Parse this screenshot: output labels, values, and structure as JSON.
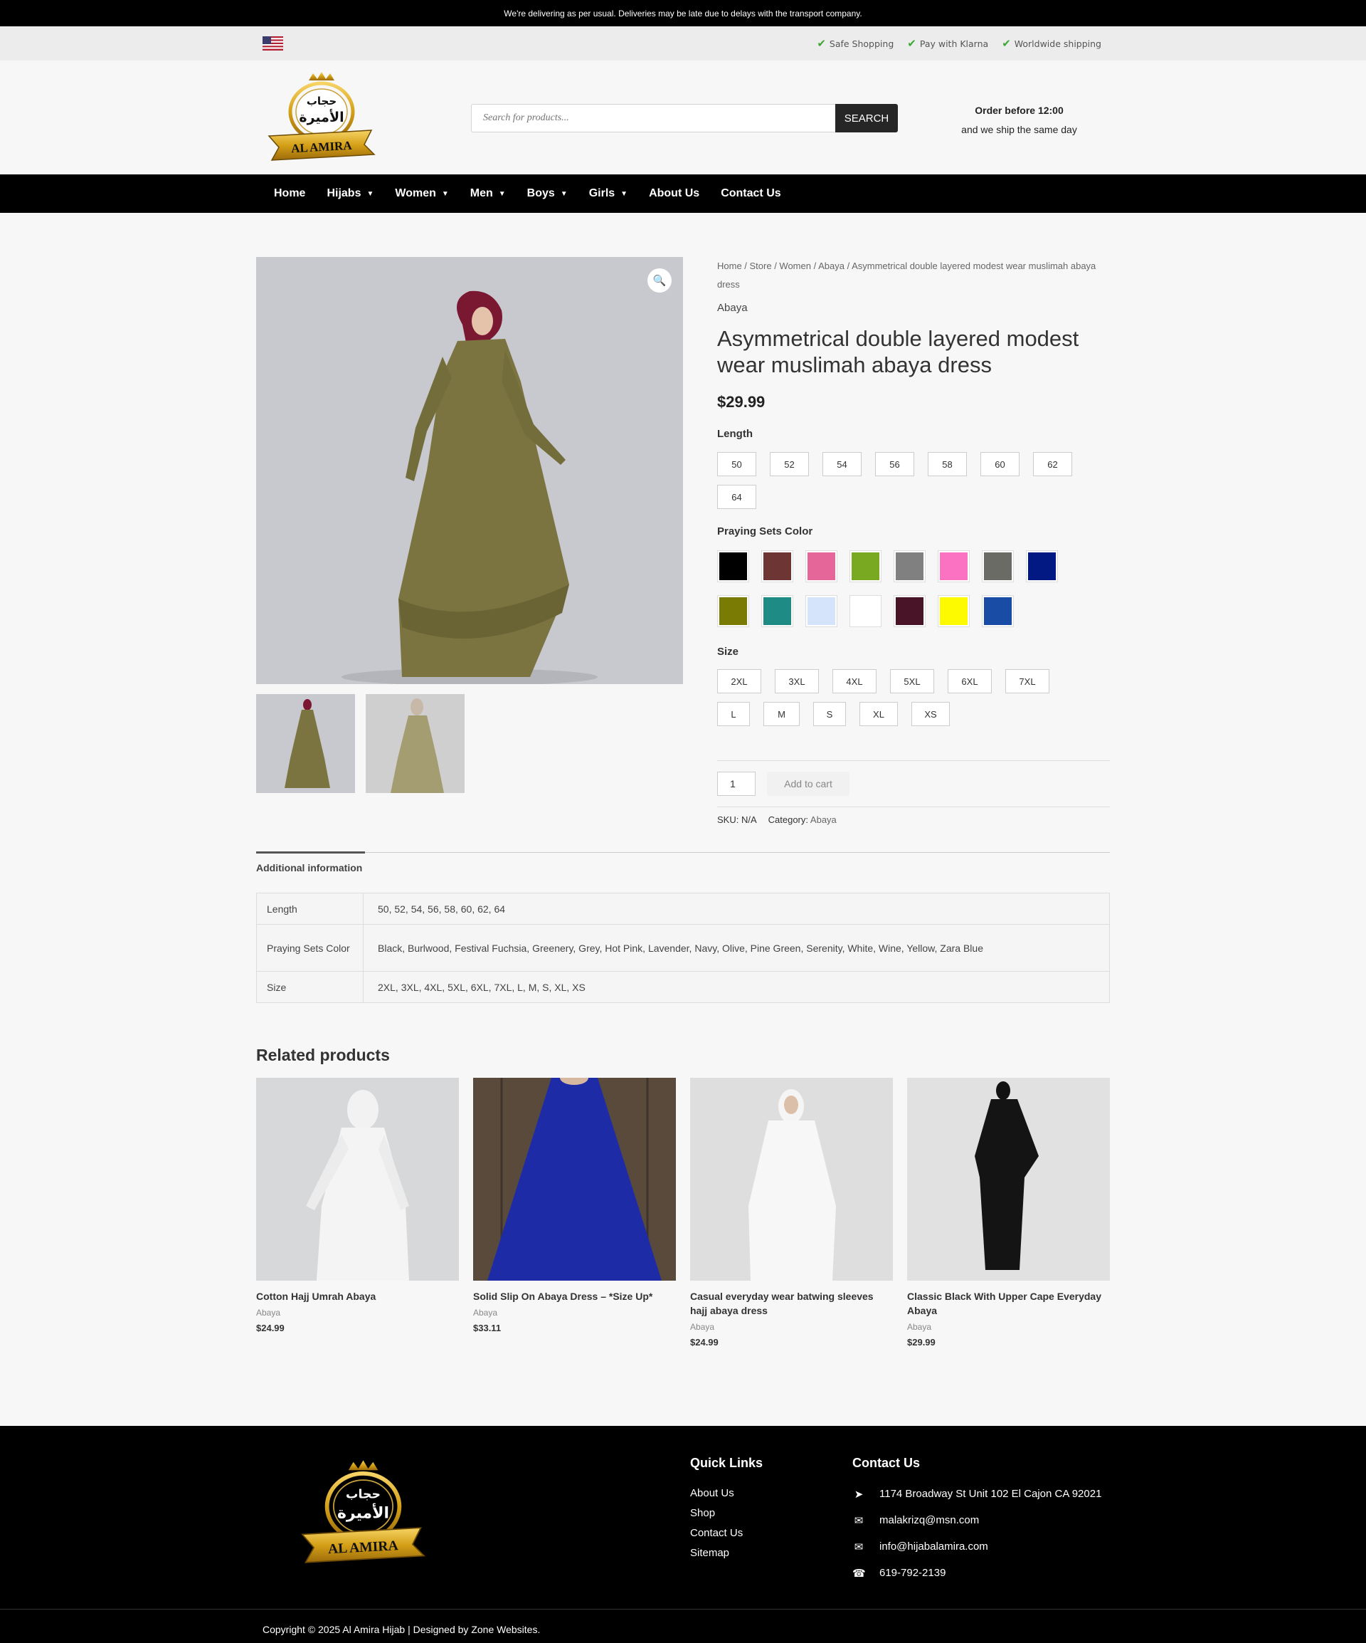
{
  "announcement": "We're delivering as per usual. Deliveries may be late due to delays with the transport company.",
  "trust_badges": [
    "Safe Shopping",
    "Pay with Klarna",
    "Worldwide shipping"
  ],
  "brand": {
    "arabic": "حجاب الأميرة",
    "name": "AL AMIRA"
  },
  "search": {
    "placeholder": "Search for products...",
    "button": "SEARCH"
  },
  "shipping_note": {
    "line1": "Order before 12:00",
    "line2": "and we ship the same day"
  },
  "nav": [
    {
      "label": "Home",
      "dropdown": false
    },
    {
      "label": "Hijabs",
      "dropdown": true
    },
    {
      "label": "Women",
      "dropdown": true
    },
    {
      "label": "Men",
      "dropdown": true
    },
    {
      "label": "Boys",
      "dropdown": true
    },
    {
      "label": "Girls",
      "dropdown": true
    },
    {
      "label": "About Us",
      "dropdown": false
    },
    {
      "label": "Contact Us",
      "dropdown": false
    }
  ],
  "product": {
    "breadcrumb": "Home / Store / Women / Abaya / Asymmetrical double layered modest wear muslimah abaya dress",
    "category": "Abaya",
    "title": "Asymmetrical double layered modest wear muslimah abaya dress",
    "price": "$29.99",
    "length_label": "Length",
    "lengths": [
      "50",
      "52",
      "54",
      "56",
      "58",
      "60",
      "62",
      "64"
    ],
    "color_label": "Praying Sets Color",
    "colors": [
      "#000000",
      "#6e3535",
      "#e5679a",
      "#79a821",
      "#808080",
      "#fa72c1",
      "#6a6b64",
      "#021883",
      "#7a7b05",
      "#1e8c84",
      "#d5e4fb",
      "#ffffff",
      "#4a1428",
      "#fdfa00",
      "#194da5"
    ],
    "size_label": "Size",
    "sizes": [
      "2XL",
      "3XL",
      "4XL",
      "5XL",
      "6XL",
      "7XL",
      "L",
      "M",
      "S",
      "XL",
      "XS"
    ],
    "qty": "1",
    "add_to_cart": "Add to cart",
    "sku_label": "SKU:",
    "sku": "N/A",
    "category_label": "Category:",
    "category_value": "Abaya"
  },
  "tab_label": "Additional information",
  "info_table": [
    {
      "key": "Length",
      "value": "50, 52, 54, 56, 58, 60, 62, 64"
    },
    {
      "key": "Praying Sets Color",
      "value": "Black, Burlwood, Festival Fuchsia, Greenery, Grey, Hot Pink, Lavender, Navy, Olive, Pine Green, Serenity, White, Wine, Yellow, Zara Blue"
    },
    {
      "key": "Size",
      "value": "2XL, 3XL, 4XL, 5XL, 6XL, 7XL, L, M, S, XL, XS"
    }
  ],
  "related_title": "Related products",
  "related": [
    {
      "name": "Cotton Hajj Umrah Abaya",
      "category": "Abaya",
      "price": "$24.99"
    },
    {
      "name": "Solid Slip On Abaya Dress – *Size Up*",
      "category": "Abaya",
      "price": "$33.11"
    },
    {
      "name": "Casual everyday wear batwing sleeves hajj abaya dress",
      "category": "Abaya",
      "price": "$24.99"
    },
    {
      "name": "Classic Black With Upper Cape Everyday Abaya",
      "category": "Abaya",
      "price": "$29.99"
    }
  ],
  "footer": {
    "quick_links_title": "Quick Links",
    "quick_links": [
      "About Us",
      "Shop",
      "Contact Us",
      "Sitemap"
    ],
    "contact_title": "Contact Us",
    "address": "1174 Broadway St Unit 102 El Cajon CA 92021",
    "email1": "malakrizq@msn.com",
    "email2": "info@hijabalamira.com",
    "phone": "619-792-2139",
    "copyright": "Copyright © 2025 Al Amira Hijab | Designed by Zone Websites."
  }
}
